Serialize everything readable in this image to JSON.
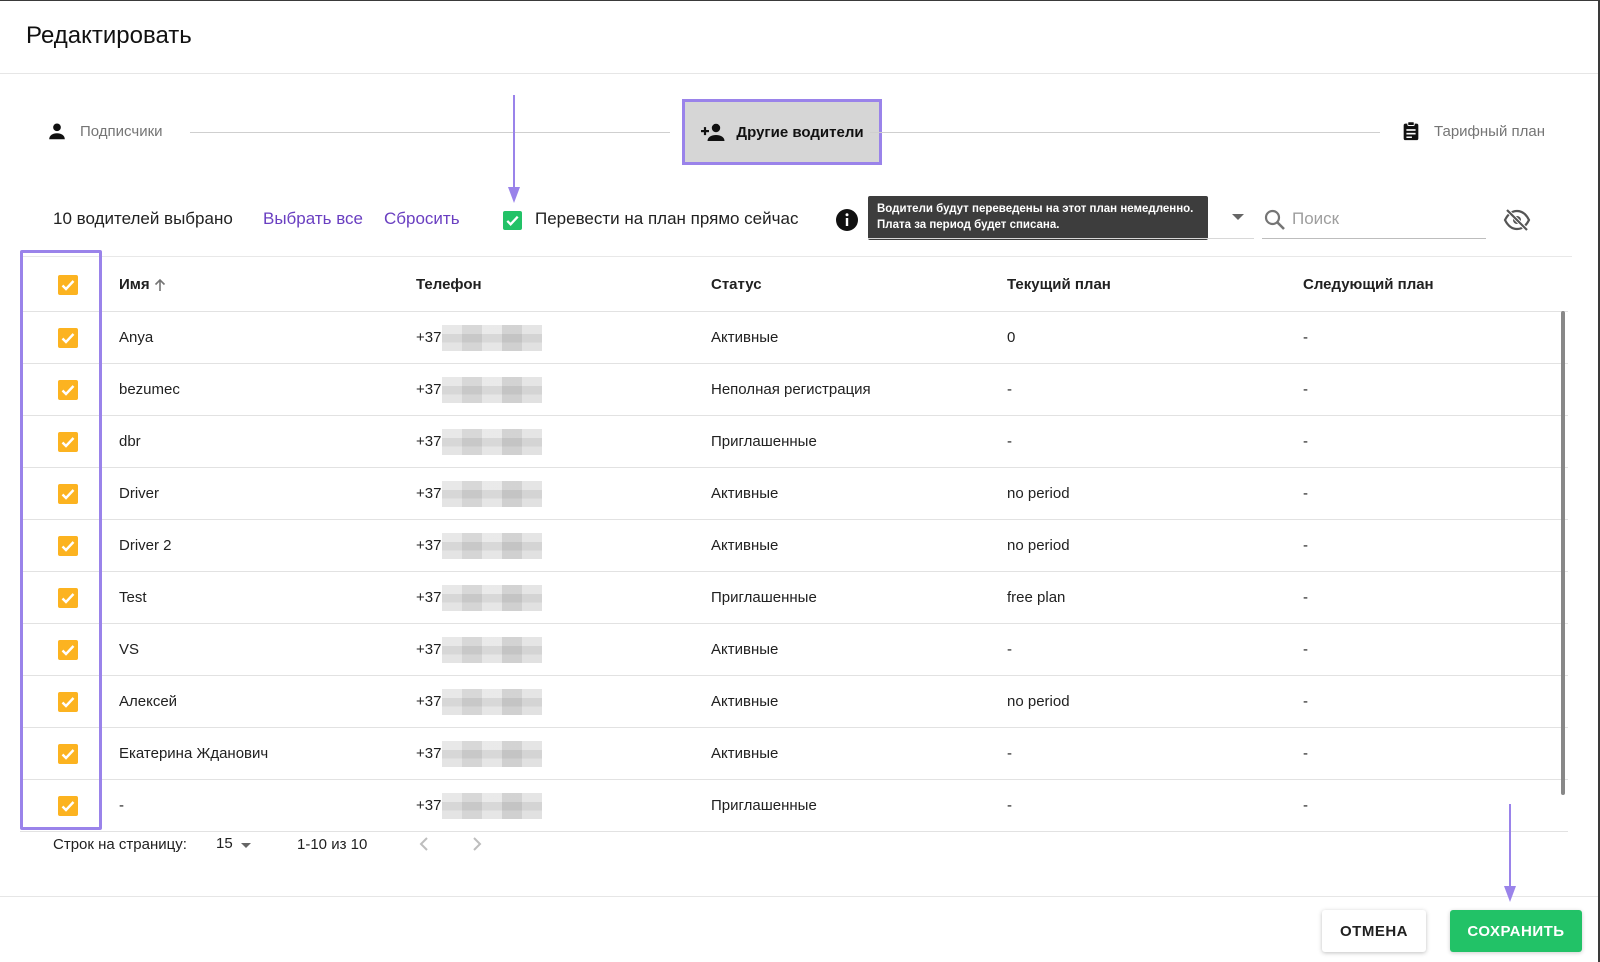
{
  "dialog": {
    "title": "Редактировать"
  },
  "stepper": {
    "steps": [
      {
        "label": "Подписчики",
        "icon": "person-icon",
        "active": false
      },
      {
        "label": "Другие водители",
        "icon": "person-add-icon",
        "active": true
      },
      {
        "label": "Тарифный план",
        "icon": "clipboard-icon",
        "active": false
      }
    ]
  },
  "toolbar": {
    "selected_count": "10 водителей выбрано",
    "select_all": "Выбрать все",
    "reset": "Сбросить",
    "transfer_now": {
      "label": "Перевести на план прямо сейчас",
      "checked": true
    },
    "tooltip_line1": "Водители будут переведены на этот план немедленно.",
    "tooltip_line2": "Плата за период будет списана.",
    "search": {
      "placeholder": "Поиск",
      "value": ""
    }
  },
  "table": {
    "headers": {
      "name": "Имя",
      "phone": "Телефон",
      "status": "Статус",
      "current_plan": "Текущий план",
      "next_plan": "Следующий план"
    },
    "rows": [
      {
        "name": "Anya",
        "phone": "+37",
        "status": "Активные",
        "current_plan": "0",
        "next_plan": "-"
      },
      {
        "name": "bezumec",
        "phone": "+37",
        "status": "Неполная регистрация",
        "current_plan": "-",
        "next_plan": "-"
      },
      {
        "name": "dbr",
        "phone": "+37",
        "status": "Приглашенные",
        "current_plan": "-",
        "next_plan": "-"
      },
      {
        "name": "Driver",
        "phone": "+37",
        "status": "Активные",
        "current_plan": "no period",
        "next_plan": "-"
      },
      {
        "name": "Driver 2",
        "phone": "+37",
        "status": "Активные",
        "current_plan": "no period",
        "next_plan": "-"
      },
      {
        "name": "Test",
        "phone": "+37",
        "status": "Приглашенные",
        "current_plan": "free plan",
        "next_plan": "-"
      },
      {
        "name": "VS",
        "phone": "+37",
        "status": "Активные",
        "current_plan": "-",
        "next_plan": "-"
      },
      {
        "name": "Алексей",
        "phone": "+37",
        "status": "Активные",
        "current_plan": "no period",
        "next_plan": "-"
      },
      {
        "name": "Екатерина Жданович",
        "phone": "+37",
        "status": "Активные",
        "current_plan": "-",
        "next_plan": "-"
      },
      {
        "name": "-",
        "phone": "+37",
        "status": "Приглашенные",
        "current_plan": "-",
        "next_plan": "-"
      }
    ]
  },
  "pagination": {
    "rows_per_page_label": "Строк на страницу:",
    "rows_per_page": "15",
    "range": "1-10 из 10"
  },
  "footer": {
    "cancel": "ОТМЕНА",
    "save": "СОХРАНИТЬ"
  },
  "colors": {
    "accent_purple": "#6a3fc1",
    "highlight_purple": "#9a83ea",
    "checkbox_yellow": "#fcb320",
    "save_green": "#22c267"
  }
}
